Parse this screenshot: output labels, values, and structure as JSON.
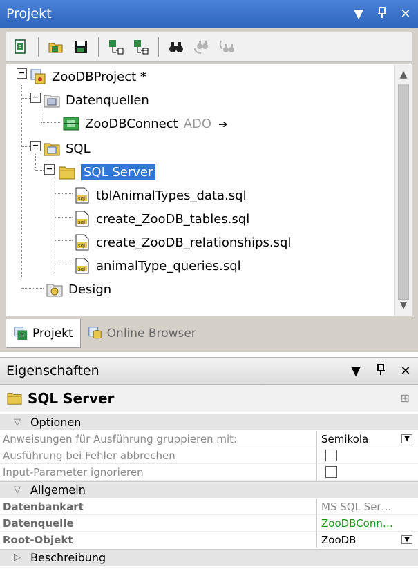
{
  "projekt_panel": {
    "title": "Projekt",
    "controls": {
      "dropdown": "▼",
      "pin": "ꟷ",
      "close": "✕"
    }
  },
  "toolbar": {
    "buttons": [
      "new-project-icon",
      "open-project-icon",
      "save-project-icon",
      "add-files-icon",
      "add-active-file-icon",
      "find-icon",
      "find-next-icon",
      "find-prev-icon"
    ]
  },
  "tree": {
    "project": {
      "label": "ZooDBProject *"
    },
    "datenquellen": {
      "label": "Datenquellen"
    },
    "connection": {
      "label": "ZooDBConnect",
      "type": "ADO",
      "arrow": "➔"
    },
    "sql": {
      "label": "SQL"
    },
    "sql_server": {
      "label": "SQL Server"
    },
    "files": [
      {
        "label": "tblAnimalTypes_data.sql"
      },
      {
        "label": "create_ZooDB_tables.sql"
      },
      {
        "label": "create_ZooDB_relationships.sql"
      },
      {
        "label": "animalType_queries.sql"
      }
    ],
    "design": {
      "label": "Design"
    }
  },
  "tabs": [
    {
      "label": "Projekt",
      "active": true
    },
    {
      "label": "Online Browser",
      "active": false
    }
  ],
  "eigenschaften_panel": {
    "title": "Eigenschaften",
    "controls": {
      "dropdown": "▼",
      "pin": "ꟷ",
      "close": "✕"
    },
    "object_name": "SQL Server",
    "sections": {
      "optionen": {
        "label": "Optionen",
        "props": [
          {
            "name": "Anweisungen für Ausführung gruppieren mit:",
            "value": "Semikola"
          },
          {
            "name": "Ausführung bei Fehler abbrechen",
            "checked": false
          },
          {
            "name": "Input-Parameter ignorieren",
            "checked": false
          }
        ]
      },
      "allgemein": {
        "label": "Allgemein",
        "props": [
          {
            "name": "Datenbankart",
            "value": "MS SQL Ser…"
          },
          {
            "name": "Datenquelle",
            "value": "ZooDBConn…"
          },
          {
            "name": "Root-Objekt",
            "value": "ZooDB"
          }
        ]
      },
      "beschreibung": {
        "label": "Beschreibung"
      }
    }
  },
  "colors": {
    "title_active": "#2f65bd",
    "selection": "#3077d8",
    "datasource_green": "#1a9a1a",
    "folder_yellow": "#e8c84a"
  }
}
